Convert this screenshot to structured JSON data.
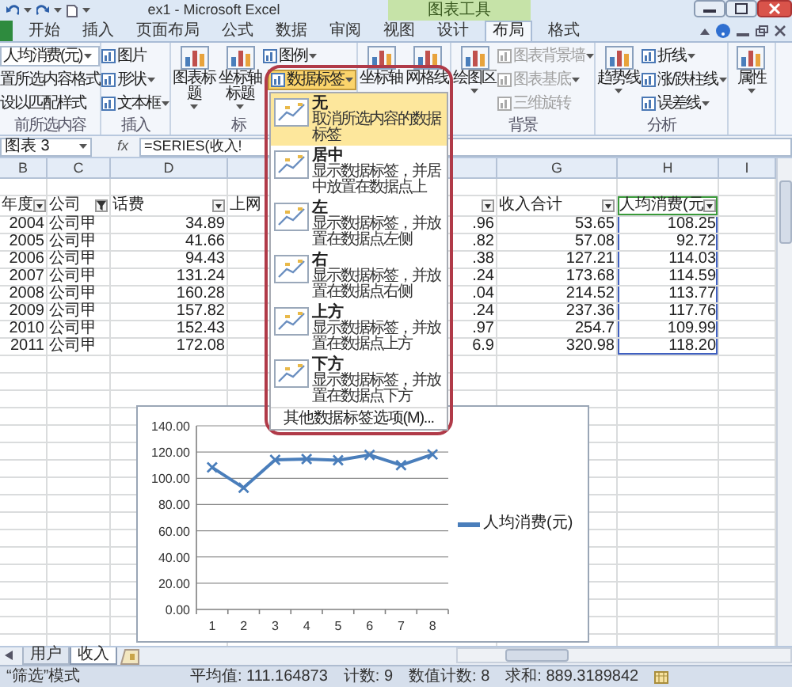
{
  "title_bar": {
    "title": "ex1 - Microsoft Excel",
    "context_tab": "图表工具"
  },
  "ribbon_tabs": [
    {
      "label": "开始",
      "selected": false
    },
    {
      "label": "插入",
      "selected": false
    },
    {
      "label": "页面布局",
      "selected": false
    },
    {
      "label": "公式",
      "selected": false
    },
    {
      "label": "数据",
      "selected": false
    },
    {
      "label": "审阅",
      "selected": false
    },
    {
      "label": "视图",
      "selected": false
    },
    {
      "label": "设计",
      "selected": false
    },
    {
      "label": "布局",
      "selected": true
    },
    {
      "label": "格式",
      "selected": false
    }
  ],
  "ribbon_groups": [
    {
      "label": "前所选内容",
      "items": [
        {
          "kind": "combo",
          "label": "人均消费(元)",
          "disabled": false
        },
        {
          "kind": "plain",
          "label": "置所选内容格式",
          "disabled": false
        },
        {
          "kind": "plain",
          "label": "设以匹配样式",
          "disabled": false
        }
      ]
    },
    {
      "label": "插入",
      "items": [
        {
          "kind": "small",
          "label": "图片",
          "disabled": false
        },
        {
          "kind": "smallmenu",
          "label": "形状",
          "disabled": false
        },
        {
          "kind": "smallmenu",
          "label": "文本框",
          "disabled": false
        }
      ]
    },
    {
      "label": "标",
      "items": [
        {
          "kind": "largemenu",
          "label": "图表标题",
          "disabled": false
        },
        {
          "kind": "largemenu",
          "label": "坐标轴标题",
          "disabled": false
        },
        {
          "kind": "smallmenu",
          "label": "图例",
          "disabled": false
        },
        {
          "kind": "open",
          "label": "数据标签",
          "disabled": false
        }
      ]
    },
    {
      "items": [
        {
          "kind": "large",
          "label": "坐标轴",
          "disabled": false
        },
        {
          "kind": "large",
          "label": "网格线",
          "disabled": false
        }
      ]
    },
    {
      "label": "背景",
      "items": [
        {
          "kind": "largemenu",
          "label": "绘图区",
          "disabled": false
        },
        {
          "kind": "smallmenu",
          "label": "图表背景墙",
          "disabled": true
        },
        {
          "kind": "smallmenu",
          "label": "图表基底",
          "disabled": true
        },
        {
          "kind": "small",
          "label": "三维旋转",
          "disabled": true
        }
      ]
    },
    {
      "label": "分析",
      "items": [
        {
          "kind": "largemenu",
          "label": "趋势线",
          "disabled": false
        },
        {
          "kind": "smallmenu",
          "label": "折线",
          "disabled": false
        },
        {
          "kind": "smallmenu",
          "label": "涨/跌柱线",
          "disabled": false
        },
        {
          "kind": "smallmenu",
          "label": "误差线",
          "disabled": false
        }
      ]
    },
    {
      "items": [
        {
          "kind": "largemenu",
          "label": "属性",
          "disabled": false
        }
      ]
    }
  ],
  "formula_bar": {
    "name_box": "图表 3",
    "function_label": "fx",
    "formula": "=SERIES(收入!"
  },
  "column_letters": [
    "B",
    "C",
    "D",
    "G",
    "H",
    "I"
  ],
  "table": {
    "header": [
      {
        "text": "年度",
        "filter": true,
        "filtered": false,
        "highlighted": false
      },
      {
        "text": "公司",
        "filter": true,
        "filtered": true,
        "highlighted": false
      },
      {
        "text": "话费",
        "filter": true,
        "filtered": false,
        "highlighted": false
      },
      {
        "text": "上网",
        "filter": true,
        "filtered": false,
        "highlighted": false
      },
      {
        "text": "收入合计",
        "filter": true,
        "filtered": false,
        "highlighted": false
      },
      {
        "text": "人均消费(元",
        "filter": true,
        "filtered": false,
        "highlighted": true
      }
    ],
    "rows": [
      [
        "2004",
        "公司甲",
        "34.89",
        ".96",
        "53.65",
        "108.25"
      ],
      [
        "2005",
        "公司甲",
        "41.66",
        ".82",
        "57.08",
        "92.72"
      ],
      [
        "2006",
        "公司甲",
        "94.43",
        ".38",
        "127.21",
        "114.03"
      ],
      [
        "2007",
        "公司甲",
        "131.24",
        ".24",
        "173.68",
        "114.59"
      ],
      [
        "2008",
        "公司甲",
        "160.28",
        ".04",
        "214.52",
        "113.77"
      ],
      [
        "2009",
        "公司甲",
        "157.82",
        ".24",
        "237.36",
        "117.76"
      ],
      [
        "2010",
        "公司甲",
        "152.43",
        ".97",
        "254.7",
        "109.99"
      ],
      [
        "2011",
        "公司甲",
        "172.08",
        "6.9",
        "320.98",
        "118.20"
      ]
    ]
  },
  "data_label_menu": {
    "items": [
      {
        "title": "无",
        "description": "取消所选内容的数据标签",
        "selected": true
      },
      {
        "title": "居中",
        "description": "显示数据标签，并居中放置在数据点上",
        "selected": false
      },
      {
        "title": "左",
        "description": "显示数据标签，并放置在数据点左侧",
        "selected": false
      },
      {
        "title": "右",
        "description": "显示数据标签，并放置在数据点右侧",
        "selected": false
      },
      {
        "title": "上方",
        "description": "显示数据标签，并放置在数据点上方",
        "selected": false
      },
      {
        "title": "下方",
        "description": "显示数据标签，并放置在数据点下方",
        "selected": false
      }
    ],
    "more": "其他数据标签选项(M)..."
  },
  "chart": {
    "chart_data": {
      "type": "line",
      "grid": true,
      "categories": [
        "1",
        "2",
        "3",
        "4",
        "5",
        "6",
        "7",
        "8"
      ],
      "series": [
        {
          "name": "人均消费(元)",
          "color": "#4a7ebb",
          "marker": "x",
          "values": [
            108.25,
            92.72,
            114.03,
            114.59,
            113.77,
            117.76,
            109.99,
            118.2
          ]
        }
      ],
      "ylim": [
        0,
        140
      ],
      "yticks": [
        {
          "value": 0,
          "label": "0.00"
        },
        {
          "value": 20,
          "label": "20.00"
        },
        {
          "value": 40,
          "label": "40.00"
        },
        {
          "value": 60,
          "label": "60.00"
        },
        {
          "value": 80,
          "label": "80.00"
        },
        {
          "value": 100,
          "label": "100.00"
        },
        {
          "value": 120,
          "label": "120.00"
        },
        {
          "value": 140,
          "label": "140.00"
        }
      ]
    }
  },
  "sheet_tabs": [
    {
      "label": "用户",
      "selected": false
    },
    {
      "label": "收入",
      "selected": true
    }
  ],
  "status_bar": {
    "mode": "“筛选”模式",
    "stats": [
      "平均值: 111.164873",
      "计数: 9",
      "数值计数: 8",
      "求和: 889.3189842"
    ]
  }
}
